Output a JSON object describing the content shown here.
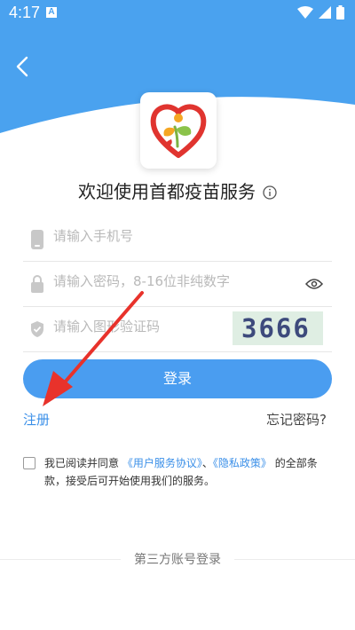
{
  "status_bar": {
    "time": "4:17",
    "notification_badge": "A"
  },
  "header": {
    "bg_color": "#4aa2ef"
  },
  "welcome": {
    "title": "欢迎使用首都疫苗服务"
  },
  "form": {
    "phone_placeholder": "请输入手机号",
    "password_placeholder": "请输入密码，8-16位非纯数字",
    "captcha_placeholder": "请输入图形验证码",
    "captcha_code": "3666",
    "login_label": "登录"
  },
  "links": {
    "register": "注册",
    "forgot_password": "忘记密码?"
  },
  "agreement": {
    "prefix": "我已阅读并同意",
    "user_agreement": "《用户服务协议》",
    "separator": "、",
    "privacy_policy": "《隐私政策》",
    "suffix": "的全部条款，接受后可开始使用我们的服务。"
  },
  "third_party": {
    "label": "第三方账号登录"
  },
  "colors": {
    "accent": "#4a9df0",
    "link": "#3a8fe8",
    "annotation_arrow": "#e8322b"
  },
  "icons": [
    "back-icon",
    "wifi-icon",
    "signal-icon",
    "battery-icon",
    "info-icon",
    "phone-icon",
    "lock-icon",
    "shield-icon",
    "eye-icon",
    "checkbox-icon"
  ]
}
